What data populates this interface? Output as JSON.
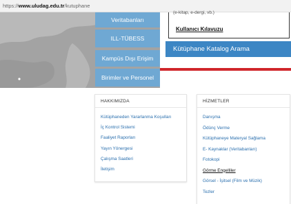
{
  "url": {
    "prefix": "https://",
    "host": "www.uludag.edu.tr",
    "path": "/kutuphane"
  },
  "nav": {
    "buttons": [
      {
        "label": "Veritabanları"
      },
      {
        "label": "ILL-TÜBESS"
      },
      {
        "label": "Kampüs Dışı Erişim"
      },
      {
        "label": "Birimler ve Personel"
      }
    ]
  },
  "dropdown": {
    "partial_text": "(e-kitap, e-dergi, vb.)",
    "guide": "Kullanıcı Kılavuzu"
  },
  "catalog": {
    "label": "Kütüphane Katalog Arama"
  },
  "hakkimizda": {
    "title": "HAKKIMIZDA",
    "items": [
      "Kütüphaneden Yararlanma Koşulları",
      "İç Kontrol Sistemi",
      "Faaliyet Raporları",
      "Yayın Yönergesi",
      "Çalışma Saatleri",
      "İletişim"
    ]
  },
  "hizmetler": {
    "title": "HİZMETLER",
    "items": [
      "Danışma",
      "Ödünç Verme",
      "Kütüphaneye Materyal Sağlama",
      "E- Kaynaklar (Veritabanları)",
      "Fotokopi",
      "Görme Engelliler",
      "Görsel - İşitsel (Film ve Müzik)",
      "Tezler"
    ]
  },
  "colors": {
    "nav_button": "#6fa8d3",
    "catalog_bar": "#3c86c4",
    "accent_red": "#d0262b",
    "link": "#2a6fae"
  }
}
